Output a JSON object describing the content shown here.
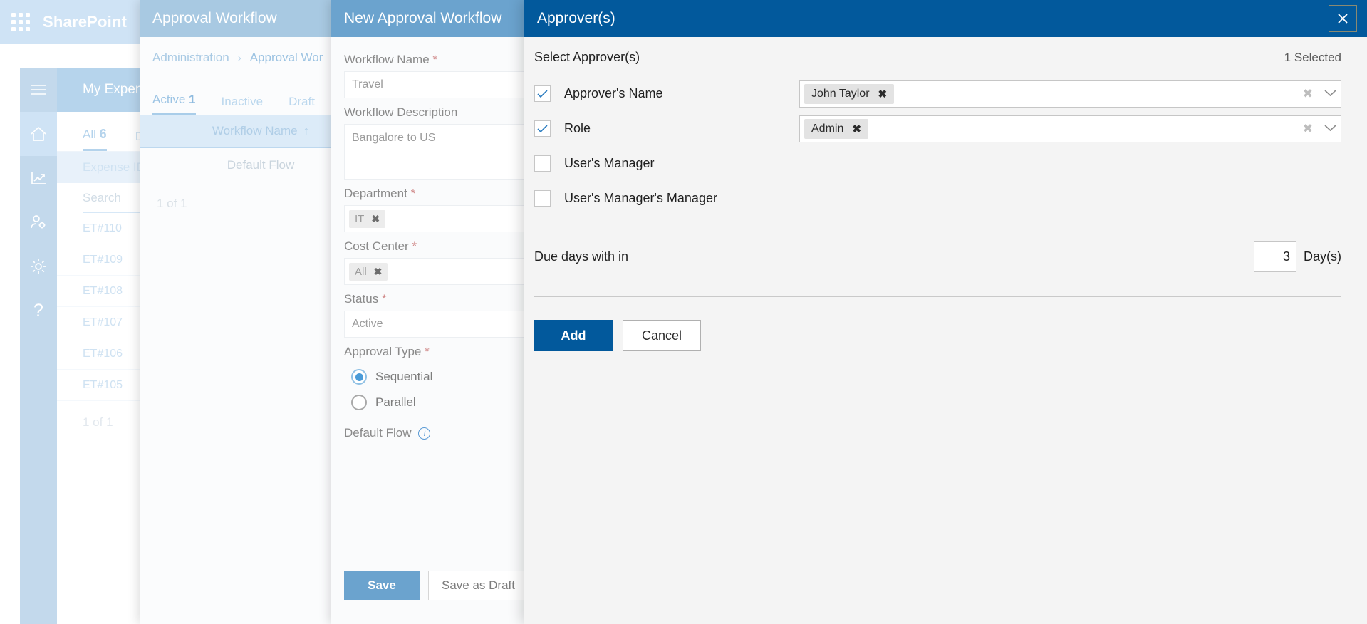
{
  "app": {
    "brand": "SharePoint",
    "waffle_icon": "app-launcher-icon"
  },
  "left_rail": {
    "items": [
      {
        "icon": "hamburger-icon",
        "name": "menu"
      },
      {
        "icon": "home-icon",
        "name": "home"
      },
      {
        "icon": "analytics-icon",
        "name": "analytics"
      },
      {
        "icon": "user-settings-icon",
        "name": "user-settings"
      },
      {
        "icon": "gear-icon",
        "name": "settings"
      },
      {
        "icon": "help-icon",
        "name": "help",
        "glyph": "?"
      }
    ]
  },
  "expenses": {
    "title": "My Expenses",
    "tabs": [
      {
        "label": "All",
        "count": "6",
        "active": true
      },
      {
        "label": "Draft",
        "count": "",
        "active": false
      }
    ],
    "column_header": "Expense ID",
    "sort_arrow": "↑",
    "search_placeholder": "Search",
    "rows": [
      "ET#110",
      "ET#109",
      "ET#108",
      "ET#107",
      "ET#106",
      "ET#105"
    ],
    "footer": "1 of 1"
  },
  "approval_workflow_panel": {
    "header": "Approval Workflow",
    "breadcrumb": {
      "root": "Administration",
      "separator": "›",
      "current": "Approval Wor"
    },
    "tabs": [
      {
        "label": "Active",
        "count": "1",
        "active": true
      },
      {
        "label": "Inactive",
        "count": "",
        "active": false
      },
      {
        "label": "Draft",
        "count": "",
        "active": false
      }
    ],
    "column_header": "Workflow Name",
    "sort_arrow": "↑",
    "rows": [
      "Default Flow"
    ],
    "footer": "1 of 1"
  },
  "new_workflow_panel": {
    "header": "New Approval Workflow",
    "fields": {
      "workflow_name_label": "Workflow Name",
      "workflow_name_value": "Travel",
      "workflow_description_label": "Workflow Description",
      "workflow_description_value": "Bangalore to US",
      "department_label": "Department",
      "department_chip": "IT",
      "cost_center_label": "Cost Center",
      "cost_center_chip": "All",
      "status_label": "Status",
      "status_value": "Active",
      "approval_type_label": "Approval Type",
      "approval_type_options": [
        "Sequential",
        "Parallel"
      ],
      "approval_type_selected": "Sequential",
      "default_flow_label": "Default Flow",
      "required_marker": "*",
      "chip_remove": "✖"
    },
    "buttons": {
      "save": "Save",
      "save_as_draft": "Save as Draft"
    }
  },
  "approver_panel": {
    "header": "Approver(s)",
    "close_icon": "close-icon",
    "subtitle": "Select Approver(s)",
    "selected_count": "1 Selected",
    "rows": [
      {
        "label": "Approver's Name",
        "checked": true,
        "has_token_input": true,
        "chip": "John Taylor",
        "chip_remove": "✖",
        "clear_icon": "clear-icon",
        "caret_icon": "chevron-down-icon"
      },
      {
        "label": "Role",
        "checked": true,
        "has_token_input": true,
        "chip": "Admin",
        "chip_remove": "✖",
        "clear_icon": "clear-icon",
        "caret_icon": "chevron-down-icon"
      },
      {
        "label": "User's Manager",
        "checked": false,
        "has_token_input": false
      },
      {
        "label": "User's Manager's Manager",
        "checked": false,
        "has_token_input": false
      }
    ],
    "due": {
      "label": "Due days with in",
      "value": "3",
      "unit": "Day(s)"
    },
    "buttons": {
      "add": "Add",
      "cancel": "Cancel"
    }
  },
  "colors": {
    "brand_blue": "#02599c",
    "panel_header_mid": "#6ba3ce",
    "panel_header_light": "#a8c9e2",
    "sharepoint_bar": "#cfe3f5"
  }
}
